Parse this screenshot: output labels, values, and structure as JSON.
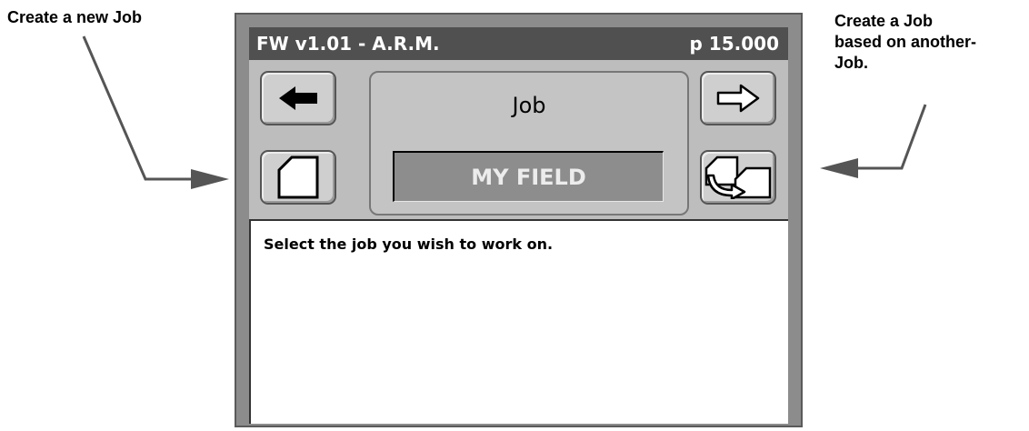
{
  "annotations": {
    "left": "Create a new Job",
    "right": "Create a Job\nbased on another-\nJob."
  },
  "screen": {
    "title_left": "FW v1.01 - A.R.M.",
    "title_right": "p 15.000",
    "center_label": "Job",
    "job_value": "MY FIELD",
    "message": "Select the job you wish to work on."
  },
  "icons": {
    "back": "left-arrow-icon",
    "next": "right-arrow-icon",
    "new": "new-page-icon",
    "copy": "copy-job-icon"
  },
  "colors": {
    "title_bar": "#505050",
    "device_frame": "#8c8c8c",
    "panel": "#bdbdbd",
    "job_field": "#8d8d8d"
  }
}
